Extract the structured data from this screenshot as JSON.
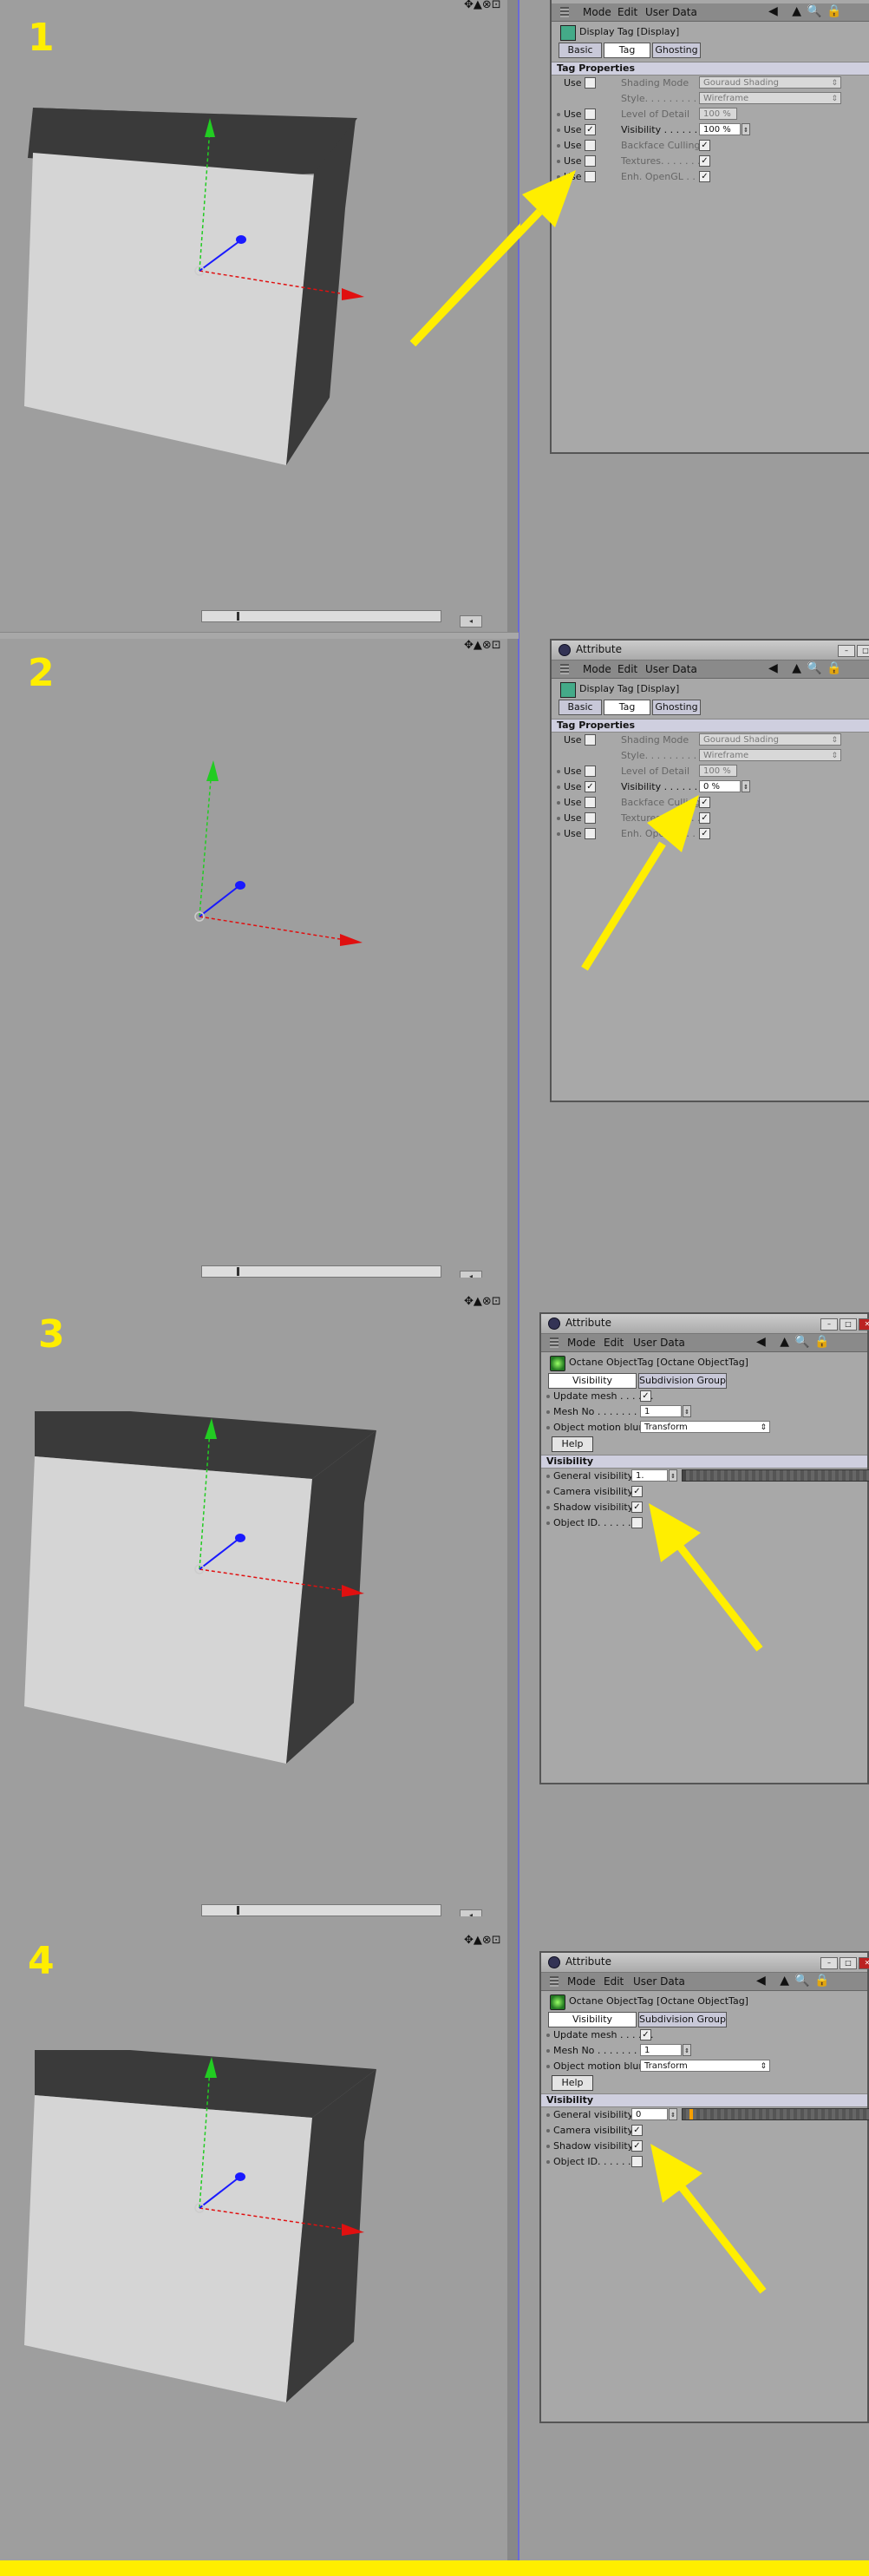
{
  "panels": [
    {
      "number": "1",
      "cube": true
    },
    {
      "number": "2",
      "cube": false
    },
    {
      "number": "3",
      "cube": true
    },
    {
      "number": "4",
      "cube": true
    }
  ],
  "display_tag": {
    "window_title": "Attribute",
    "menu": [
      "Mode",
      "Edit",
      "User Data"
    ],
    "tag_name": "Display Tag [Display]",
    "tabs": [
      "Basic",
      "Tag",
      "Ghosting"
    ],
    "section": "Tag Properties",
    "use_label": "Use",
    "shading_mode_label": "Shading Mode",
    "shading_mode_value": "Gouraud Shading",
    "style_label": "Style. . . . . . . . . .",
    "style_value": "Wireframe",
    "lod_label": "Level of Detail",
    "lod_value": "100 %",
    "visibility_label": "Visibility . . . . . .",
    "visibility_value_1": "100 %",
    "visibility_value_2": "0 %",
    "backface_label": "Backface Culling",
    "textures_label": "Textures. . . . . . .",
    "opengl_label": "Enh. OpenGL . . ."
  },
  "octane_tag": {
    "window_title": "Attribute",
    "menu": [
      "Mode",
      "Edit",
      "User Data"
    ],
    "tag_name": "Octane ObjectTag [Octane ObjectTag]",
    "tabs": [
      "Visibility",
      "Subdivision Group"
    ],
    "update_mesh_label": "Update mesh . . . . . .",
    "mesh_no_label": "Mesh No . . . . . . . .",
    "mesh_no_value": "1",
    "motion_blur_label": "Object motion blur",
    "motion_blur_value": "Transform",
    "help_label": "Help",
    "section": "Visibility",
    "general_visibility_label": "General visibility",
    "general_visibility_value_3": "1.",
    "general_visibility_value_4": "0",
    "camera_visibility_label": "Camera visibility",
    "shadow_visibility_label": "Shadow visibility",
    "object_id_label": "Object ID. . . . . . ."
  },
  "check_mark": "✓",
  "accent": "#ffee00"
}
